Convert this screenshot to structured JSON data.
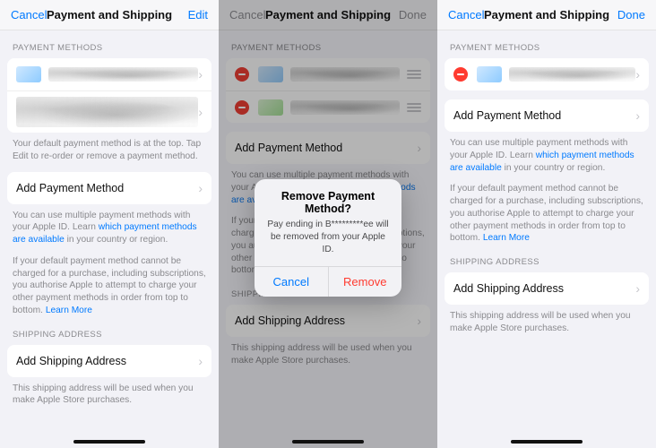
{
  "nav": {
    "cancel": "Cancel",
    "title": "Payment and Shipping",
    "edit": "Edit",
    "done": "Done"
  },
  "sec": {
    "payment_methods": "PAYMENT METHODS",
    "shipping_address": "SHIPPING ADDRESS"
  },
  "rows": {
    "add_payment": "Add Payment Method",
    "add_shipping": "Add Shipping Address"
  },
  "foot": {
    "reorder": "Your default payment method is at the top. Tap Edit to re-order or remove a payment method.",
    "multi_a": "You can use multiple payment methods with your Apple ID. Learn ",
    "multi_link": "which payment methods are available",
    "multi_b": " in your country or region.",
    "charge_a": "If your default payment method cannot be charged for a purchase, including subscriptions, you authorise Apple to attempt to charge your other payment methods in order from top to bottom. ",
    "learn_more": "Learn More",
    "shipping_note": "This shipping address will be used when you make Apple Store purchases."
  },
  "alert": {
    "title": "Remove Payment Method?",
    "msg": "Pay ending in B*********ee will be removed from your Apple ID.",
    "cancel": "Cancel",
    "remove": "Remove"
  }
}
